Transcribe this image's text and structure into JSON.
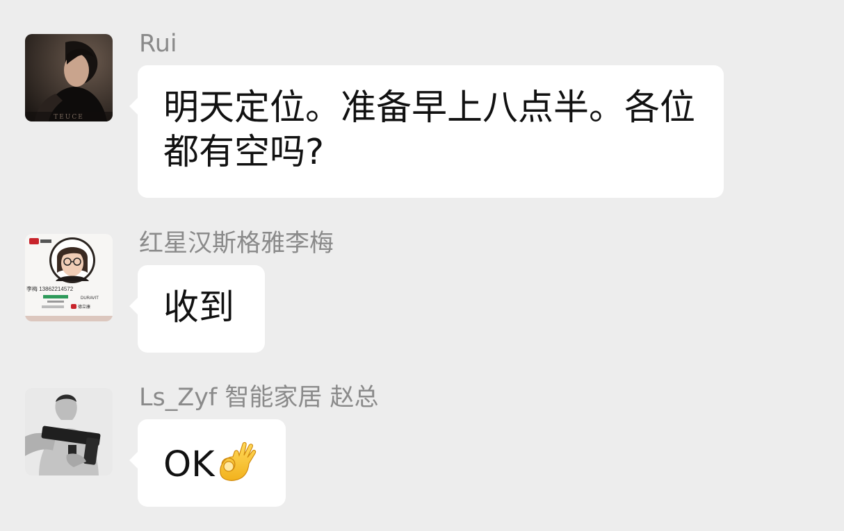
{
  "messages": [
    {
      "sender": "Rui",
      "text": "明天定位。准备早上八点半。各位都有空吗?",
      "avatar_icon": "man-in-black-turtleneck-avatar",
      "avatar_caption": "TEUCE"
    },
    {
      "sender": "红星汉斯格雅李梅",
      "text": "收到",
      "avatar_icon": "business-card-woman-glasses-avatar",
      "avatar_card_text": "李梅 13862214572",
      "avatar_brand_text": "DURAVIT",
      "avatar_brand_text_2": "德立康"
    },
    {
      "sender": "Ls_Zyf 智能家居 赵总",
      "text": "OK",
      "emoji_icon": "ok-hand-emoji",
      "avatar_icon": "man-holding-gun-avatar"
    }
  ],
  "colors": {
    "background": "#ededed",
    "bubble": "#ffffff",
    "sender_name": "#8a8a8a",
    "message_text": "#111111"
  }
}
